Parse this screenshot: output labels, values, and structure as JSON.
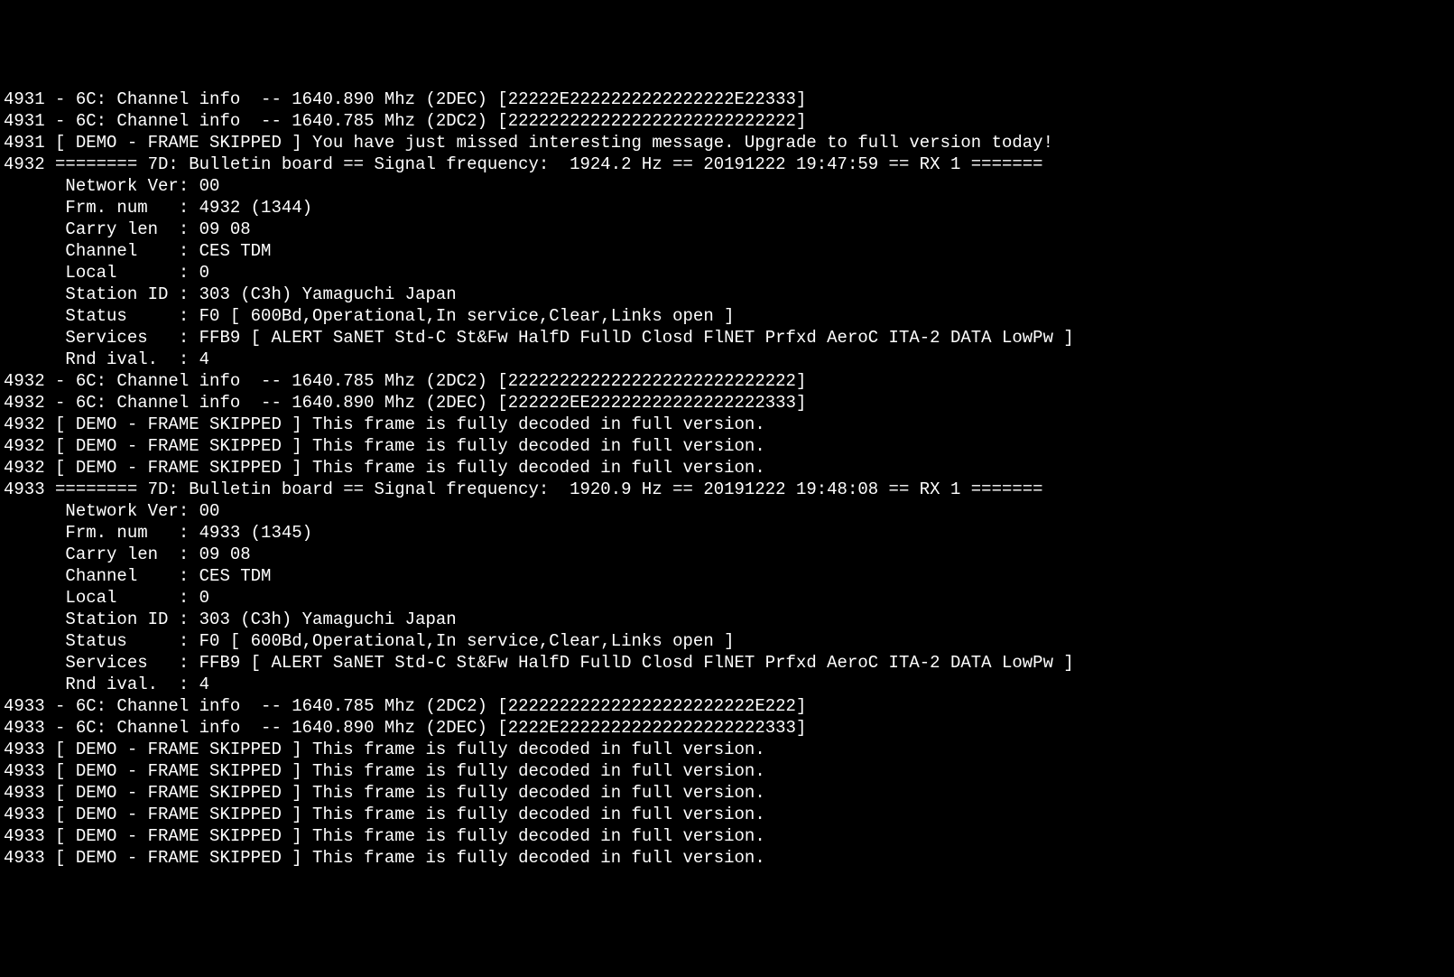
{
  "lines": [
    "4931 - 6C: Channel info  -- 1640.890 Mhz (2DEC) [22222E2222222222222222E22333]",
    "4931 - 6C: Channel info  -- 1640.785 Mhz (2DC2) [2222222222222222222222222222]",
    "4931 [ DEMO - FRAME SKIPPED ] You have just missed interesting message. Upgrade to full version today!",
    "4932 ======== 7D: Bulletin board == Signal frequency:  1924.2 Hz == 20191222 19:47:59 == RX 1 =======",
    "      Network Ver: 00",
    "      Frm. num   : 4932 (1344)",
    "      Carry len  : 09 08",
    "      Channel    : CES TDM",
    "      Local      : 0",
    "      Station ID : 303 (C3h) Yamaguchi Japan",
    "      Status     : F0 [ 600Bd,Operational,In service,Clear,Links open ]",
    "      Services   : FFB9 [ ALERT SaNET Std-C St&Fw HalfD FullD Closd FlNET Prfxd AeroC ITA-2 DATA LowPw ]",
    "      Rnd ival.  : 4",
    "4932 - 6C: Channel info  -- 1640.785 Mhz (2DC2) [2222222222222222222222222222]",
    "4932 - 6C: Channel info  -- 1640.890 Mhz (2DEC) [222222EE22222222222222222333]",
    "4932 [ DEMO - FRAME SKIPPED ] This frame is fully decoded in full version.",
    "4932 [ DEMO - FRAME SKIPPED ] This frame is fully decoded in full version.",
    "4932 [ DEMO - FRAME SKIPPED ] This frame is fully decoded in full version.",
    "4933 ======== 7D: Bulletin board == Signal frequency:  1920.9 Hz == 20191222 19:48:08 == RX 1 =======",
    "      Network Ver: 00",
    "      Frm. num   : 4933 (1345)",
    "      Carry len  : 09 08",
    "      Channel    : CES TDM",
    "      Local      : 0",
    "      Station ID : 303 (C3h) Yamaguchi Japan",
    "      Status     : F0 [ 600Bd,Operational,In service,Clear,Links open ]",
    "      Services   : FFB9 [ ALERT SaNET Std-C St&Fw HalfD FullD Closd FlNET Prfxd AeroC ITA-2 DATA LowPw ]",
    "      Rnd ival.  : 4",
    "4933 - 6C: Channel info  -- 1640.785 Mhz (2DC2) [222222222222222222222222E222]",
    "4933 - 6C: Channel info  -- 1640.890 Mhz (2DEC) [2222E22222222222222222222333]",
    "4933 [ DEMO - FRAME SKIPPED ] This frame is fully decoded in full version.",
    "4933 [ DEMO - FRAME SKIPPED ] This frame is fully decoded in full version.",
    "4933 [ DEMO - FRAME SKIPPED ] This frame is fully decoded in full version.",
    "4933 [ DEMO - FRAME SKIPPED ] This frame is fully decoded in full version.",
    "4933 [ DEMO - FRAME SKIPPED ] This frame is fully decoded in full version.",
    "4933 [ DEMO - FRAME SKIPPED ] This frame is fully decoded in full version."
  ]
}
